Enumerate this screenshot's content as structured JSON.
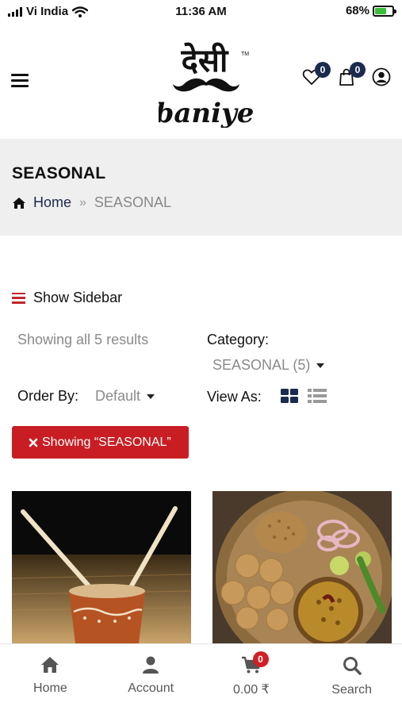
{
  "status_bar": {
    "carrier": "Vi India",
    "time": "11:36 AM",
    "battery": "68%",
    "battery_level": 0.68
  },
  "header": {
    "logo_script": "देसी",
    "logo_text": "baniye",
    "logo_tm": "TM",
    "wishlist_count": "0",
    "cart_count": "0"
  },
  "page": {
    "title": "SEASONAL",
    "breadcrumb": {
      "home": "Home",
      "separator": "»",
      "current": "SEASONAL"
    }
  },
  "toolbar": {
    "show_sidebar": "Show Sidebar",
    "results": "Showing all 5 results",
    "category_label": "Category:",
    "category_value": "SEASONAL (5)",
    "order_label": "Order By:",
    "order_value": "Default",
    "view_label": "View As:",
    "filter_chip": "Showing “SEASONAL”"
  },
  "products": [
    {
      "icon": "kulhad-chai-image"
    },
    {
      "icon": "dal-baati-thali-image"
    }
  ],
  "bottom_nav": {
    "home": "Home",
    "account": "Account",
    "cart_total": "0.00 ₹",
    "cart_count": "0",
    "search": "Search"
  },
  "colors": {
    "brand_navy": "#1b2a4e",
    "accent_red": "#c81e23",
    "band_grey": "#efefef"
  }
}
